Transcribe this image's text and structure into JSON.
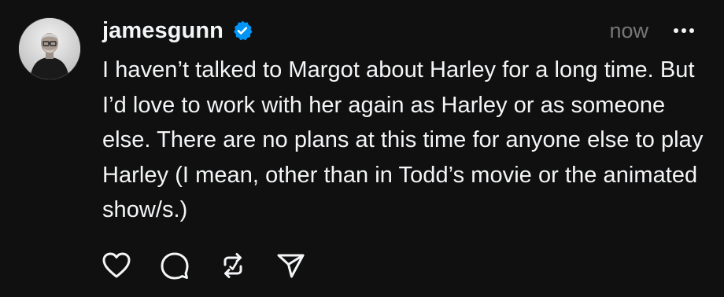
{
  "post": {
    "author": {
      "username": "jamesgunn",
      "avatar_icon": "avatar-photo",
      "verified_icon": "verified-badge-icon",
      "verified_color": "#0095f6"
    },
    "timestamp": "now",
    "more_icon": "more-horizontal-icon",
    "text": "I haven’t talked to Margot about Harley for a long time. But I’d love to work with her again as Harley or as someone else. There are no plans at this time for anyone else to play Harley (I mean, other than in Todd’s movie or the animated show/s.)",
    "actions": [
      {
        "icon": "heart-icon",
        "label": "like"
      },
      {
        "icon": "comment-icon",
        "label": "reply"
      },
      {
        "icon": "repost-icon",
        "label": "repost"
      },
      {
        "icon": "send-icon",
        "label": "share"
      }
    ]
  },
  "colors": {
    "background": "#101010",
    "text": "#f3f5f7",
    "muted": "#777777"
  }
}
